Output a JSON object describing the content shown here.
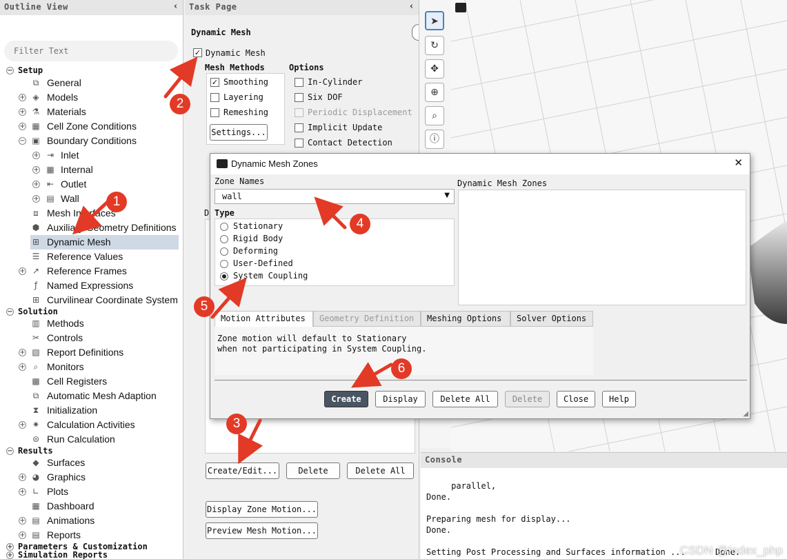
{
  "outline": {
    "title": "Outline View",
    "collapse_glyph": "‹",
    "filter_placeholder": "Filter Text",
    "items": [
      {
        "label": "Setup",
        "section": true,
        "expander": "−"
      },
      {
        "label": "General",
        "icon": "general-icon",
        "glyph": "⧉"
      },
      {
        "label": "Models",
        "icon": "models-icon",
        "glyph": "◈",
        "expander": "+"
      },
      {
        "label": "Materials",
        "icon": "materials-icon",
        "glyph": "⚗",
        "expander": "+"
      },
      {
        "label": "Cell Zone Conditions",
        "icon": "cell-zone-icon",
        "glyph": "▦",
        "expander": "+"
      },
      {
        "label": "Boundary Conditions",
        "icon": "boundary-icon",
        "glyph": "▣",
        "expander": "−"
      },
      {
        "label": "Inlet",
        "icon": "inlet-icon",
        "glyph": "⇥",
        "expander": "+"
      },
      {
        "label": "Internal",
        "icon": "internal-icon",
        "glyph": "▦",
        "expander": "+"
      },
      {
        "label": "Outlet",
        "icon": "outlet-icon",
        "glyph": "⇤",
        "expander": "+"
      },
      {
        "label": "Wall",
        "icon": "wall-icon",
        "glyph": "▤",
        "expander": "+"
      },
      {
        "label": "Mesh Interfaces",
        "icon": "mesh-interfaces-icon",
        "glyph": "⧈"
      },
      {
        "label": "Auxiliary Geometry Definitions",
        "icon": "aux-geometry-icon",
        "glyph": "⬢"
      },
      {
        "label": "Dynamic Mesh",
        "icon": "dynamic-mesh-icon",
        "glyph": "⊞",
        "selected": true
      },
      {
        "label": "Reference Values",
        "icon": "reference-values-icon",
        "glyph": "☰"
      },
      {
        "label": "Reference Frames",
        "icon": "reference-frames-icon",
        "glyph": "↗",
        "expander": "+"
      },
      {
        "label": "Named Expressions",
        "icon": "named-expressions-icon",
        "glyph": "ƒ"
      },
      {
        "label": "Curvilinear Coordinate System",
        "icon": "curvilinear-icon",
        "glyph": "⊞"
      },
      {
        "label": "Solution",
        "section": true,
        "expander": "−"
      },
      {
        "label": "Methods",
        "icon": "methods-icon",
        "glyph": "▥"
      },
      {
        "label": "Controls",
        "icon": "controls-icon",
        "glyph": "✂"
      },
      {
        "label": "Report Definitions",
        "icon": "report-definitions-icon",
        "glyph": "▧",
        "expander": "+"
      },
      {
        "label": "Monitors",
        "icon": "monitors-icon",
        "glyph": "⌕",
        "expander": "+"
      },
      {
        "label": "Cell Registers",
        "icon": "cell-registers-icon",
        "glyph": "▩"
      },
      {
        "label": "Automatic Mesh Adaption",
        "icon": "mesh-adaption-icon",
        "glyph": "⧉"
      },
      {
        "label": "Initialization",
        "icon": "initialization-icon",
        "glyph": "⧗"
      },
      {
        "label": "Calculation Activities",
        "icon": "calc-activities-icon",
        "glyph": "✷",
        "expander": "+"
      },
      {
        "label": "Run Calculation",
        "icon": "run-calculation-icon",
        "glyph": "⊜"
      },
      {
        "label": "Results",
        "section": true,
        "expander": "−"
      },
      {
        "label": "Surfaces",
        "icon": "surfaces-icon",
        "glyph": "◆"
      },
      {
        "label": "Graphics",
        "icon": "graphics-icon",
        "glyph": "◕",
        "expander": "+"
      },
      {
        "label": "Plots",
        "icon": "plots-icon",
        "glyph": "∟",
        "expander": "+"
      },
      {
        "label": "Dashboard",
        "icon": "dashboard-icon",
        "glyph": "▦"
      },
      {
        "label": "Animations",
        "icon": "animations-icon",
        "glyph": "▤",
        "expander": "+"
      },
      {
        "label": "Reports",
        "icon": "reports-icon",
        "glyph": "▤",
        "expander": "+"
      },
      {
        "label": "Parameters & Customization",
        "section": true,
        "expander": "+"
      },
      {
        "label": "Simulation Reports",
        "section": true,
        "expander": "+"
      }
    ]
  },
  "task": {
    "title": "Task Page",
    "collapse_glyph": "‹",
    "section_title": "Dynamic Mesh",
    "dynamic_mesh_label": "Dynamic Mesh",
    "dynamic_mesh_checked": true,
    "mesh_methods_title": "Mesh Methods",
    "methods": [
      {
        "label": "Smoothing",
        "checked": true
      },
      {
        "label": "Layering",
        "checked": false
      },
      {
        "label": "Remeshing",
        "checked": false
      }
    ],
    "settings_button": "Settings...",
    "options_title": "Options",
    "options": [
      {
        "label": "In-Cylinder",
        "checked": false,
        "disabled": false
      },
      {
        "label": "Six DOF",
        "checked": false,
        "disabled": false
      },
      {
        "label": "Periodic Displacement",
        "checked": false,
        "disabled": true
      },
      {
        "label": "Implicit Update",
        "checked": false,
        "disabled": false
      },
      {
        "label": "Contact Detection",
        "checked": false,
        "disabled": false
      }
    ],
    "zones_letter": "D",
    "create_edit_button": "Create/Edit...",
    "delete_button": "Delete",
    "delete_all_button": "Delete All",
    "display_zone_motion_button": "Display Zone Motion...",
    "preview_mesh_motion_button": "Preview Mesh Motion..."
  },
  "toolbar": {
    "tools": [
      {
        "name": "select-pointer-icon",
        "glyph": "➤",
        "active": true
      },
      {
        "name": "rotate-icon",
        "glyph": "↻"
      },
      {
        "name": "pan-icon",
        "glyph": "✥"
      },
      {
        "name": "zoom-in-out-icon",
        "glyph": "⊕"
      },
      {
        "name": "zoom-to-area-icon",
        "glyph": "⌕"
      },
      {
        "name": "info-icon",
        "glyph": "ⓘ"
      }
    ]
  },
  "dialog": {
    "title": "Dynamic Mesh Zones",
    "close_glyph": "✕",
    "zone_names_label": "Zone Names",
    "zone_name_value": "wall",
    "dynamic_mesh_zones_label": "Dynamic Mesh Zones",
    "type_label": "Type",
    "types": [
      {
        "label": "Stationary",
        "selected": false
      },
      {
        "label": "Rigid Body",
        "selected": false
      },
      {
        "label": "Deforming",
        "selected": false
      },
      {
        "label": "User-Defined",
        "selected": false
      },
      {
        "label": "System Coupling",
        "selected": true
      }
    ],
    "tabs": [
      {
        "label": "Motion Attributes",
        "active": true,
        "disabled": false
      },
      {
        "label": "Geometry Definition",
        "active": false,
        "disabled": true
      },
      {
        "label": "Meshing Options",
        "active": false,
        "disabled": false
      },
      {
        "label": "Solver Options",
        "active": false,
        "disabled": false
      }
    ],
    "message_line1": "Zone motion will default to Stationary",
    "message_line2": "when not participating in System Coupling.",
    "buttons": {
      "create": "Create",
      "display": "Display",
      "delete_all": "Delete All",
      "delete": "Delete",
      "close": "Close",
      "help": "Help"
    }
  },
  "console": {
    "title": "Console",
    "lines": [
      "     parallel,",
      "Done.",
      "",
      "Preparing mesh for display...",
      "Done.",
      "",
      "Setting Post Processing and Surfaces information ...      Done."
    ]
  },
  "annotations": {
    "markers": [
      "1",
      "2",
      "3",
      "4",
      "5",
      "6"
    ],
    "arrow_color": "#e23a26"
  },
  "watermark": "CSDN @Index_php",
  "colors": {
    "selection": "#cfd9e6",
    "primary_button": "#4a5563",
    "marker_red": "#e23a26"
  }
}
